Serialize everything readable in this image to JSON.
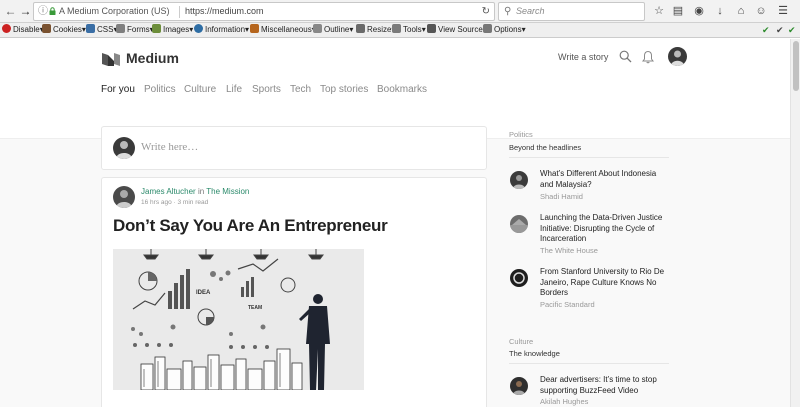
{
  "browser": {
    "site_identity": "A Medium Corporation (US)",
    "url": "https://medium.com",
    "search_placeholder": "Search"
  },
  "devbar": {
    "items": [
      {
        "label": "Disable",
        "color": "#cc2222"
      },
      {
        "label": "Cookies",
        "color": "#7a5230"
      },
      {
        "label": "CSS",
        "color": "#3a6ea5"
      },
      {
        "label": "Forms",
        "color": "#7f7f7f"
      },
      {
        "label": "Images",
        "color": "#6d8e3b"
      },
      {
        "label": "Information",
        "color": "#2e6da4"
      },
      {
        "label": "Miscellaneous",
        "color": "#b5651d"
      },
      {
        "label": "Outline",
        "color": "#888888"
      },
      {
        "label": "Resize",
        "color": "#6a6a6a"
      },
      {
        "label": "Tools",
        "color": "#7a7a7a"
      },
      {
        "label": "View Source",
        "color": "#555555"
      },
      {
        "label": "Options",
        "color": "#777777"
      }
    ]
  },
  "header": {
    "brand": "Medium",
    "write_story": "Write a story"
  },
  "nav": {
    "tabs": [
      "For you",
      "Politics",
      "Culture",
      "Life",
      "Sports",
      "Tech",
      "Top stories",
      "Bookmarks"
    ]
  },
  "composer": {
    "placeholder": "Write here…"
  },
  "post": {
    "author": "James Altucher",
    "in_word": "in",
    "publication": "The Mission",
    "age": "16 hrs ago",
    "read_time": "3 min read",
    "title": "Don’t Say You Are An Entrepreneur",
    "image_words": [
      "IDEA",
      "TEAM"
    ]
  },
  "sidebar": {
    "sections": [
      {
        "category": "Politics",
        "headline": "Beyond the headlines",
        "items": [
          {
            "title": "What’s Different About Indonesia and Malaysia?",
            "source": "Shadi Hamid",
            "thumb": "#3b3b3b"
          },
          {
            "title": "Launching the Data-Driven Justice Initiative: Disrupting the Cycle of Incarceration",
            "source": "The White House",
            "thumb": "#6d6d6d"
          },
          {
            "title": "From Stanford University to Rio De Janeiro, Rape Culture Knows No Borders",
            "source": "Pacific Standard",
            "thumb": "#1e1e1e"
          }
        ]
      },
      {
        "category": "Culture",
        "headline": "The knowledge",
        "items": [
          {
            "title": "Dear advertisers: It’s time to stop supporting BuzzFeed Video",
            "source": "Akilah Hughes",
            "thumb": "#2f2f2f"
          }
        ]
      }
    ]
  },
  "colors": {
    "accent": "#2b8a6b",
    "text": "#333333",
    "muted": "#999999"
  }
}
